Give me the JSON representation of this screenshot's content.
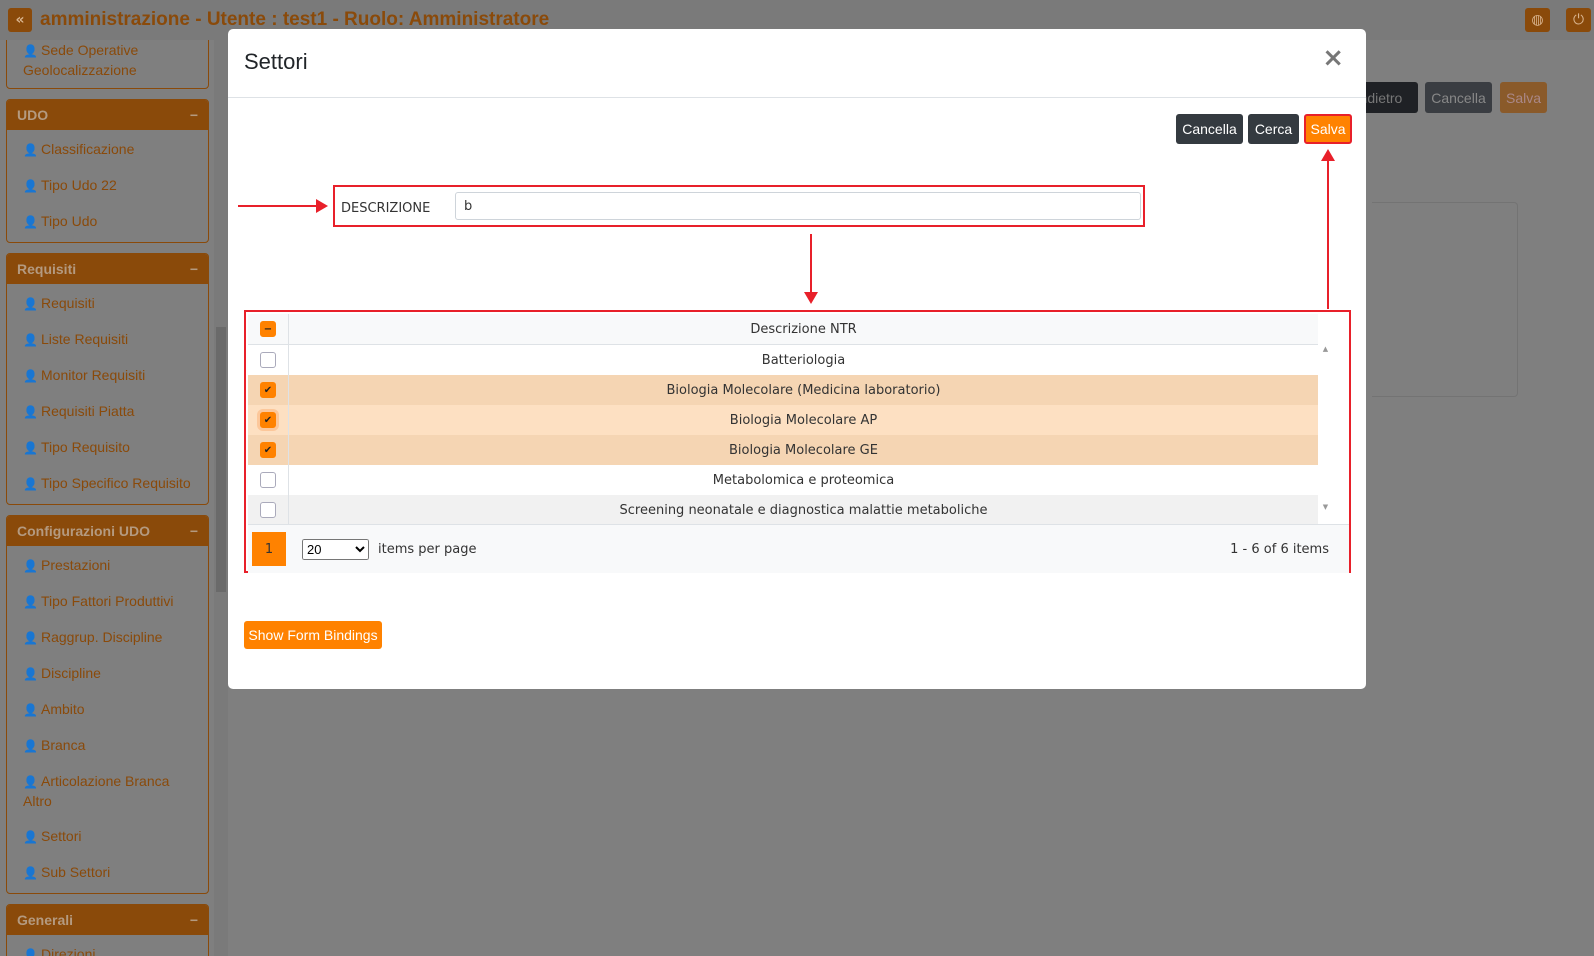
{
  "header": {
    "title": "amministrazione - Utente : test1 - Ruolo: Amministratore",
    "collapse_icon": "«",
    "globe_icon": "globe-icon",
    "power_icon": "power-icon"
  },
  "sidebar": {
    "partial_item": {
      "line1": "Sede Operative",
      "line2": "Geolocalizzazione"
    },
    "sections": [
      {
        "title": "UDO",
        "items": [
          "Classificazione",
          "Tipo Udo 22",
          "Tipo Udo"
        ]
      },
      {
        "title": "Requisiti",
        "items": [
          "Requisiti",
          "Liste Requisiti",
          "Monitor Requisiti",
          "Requisiti Piatta",
          "Tipo Requisito",
          "Tipo Specifico Requisito"
        ]
      },
      {
        "title": "Configurazioni UDO",
        "items": [
          "Prestazioni",
          "Tipo Fattori Produttivi",
          "Raggrup. Discipline",
          "Discipline",
          "Ambito",
          "Branca",
          "Articolazione Branca Altro",
          "Settori",
          "Sub Settori"
        ]
      },
      {
        "title": "Generali",
        "items": [
          "Direzioni"
        ]
      }
    ],
    "collapse_symbol": "−"
  },
  "background_toolbar": {
    "back": "Indietro",
    "cancel": "Cancella",
    "save": "Salva"
  },
  "modal": {
    "title": "Settori",
    "close": "×",
    "buttons": {
      "cancel": "Cancella",
      "search": "Cerca",
      "save": "Salva"
    },
    "filter": {
      "label": "DESCRIZIONE",
      "value": "b"
    },
    "grid": {
      "column": "Descrizione NTR",
      "rows": [
        {
          "label": "Batteriologia",
          "checked": false
        },
        {
          "label": "Biologia Molecolare (Medicina laboratorio)",
          "checked": true
        },
        {
          "label": "Biologia Molecolare AP",
          "checked": true
        },
        {
          "label": "Biologia Molecolare GE",
          "checked": true
        },
        {
          "label": "Metabolomica e proteomica",
          "checked": false
        },
        {
          "label": "Screening neonatale e diagnostica malattie metaboliche",
          "checked": false
        }
      ],
      "page": "1",
      "page_size": "20",
      "items_per_page": "items per page",
      "count": "1 - 6 of 6 items"
    },
    "show_bindings": "Show Form Bindings"
  },
  "colors": {
    "accent": "#ff8200",
    "annotation": "#e8202a",
    "selected_row": "#f5d5b3",
    "hover_row": "#fde0c2"
  }
}
